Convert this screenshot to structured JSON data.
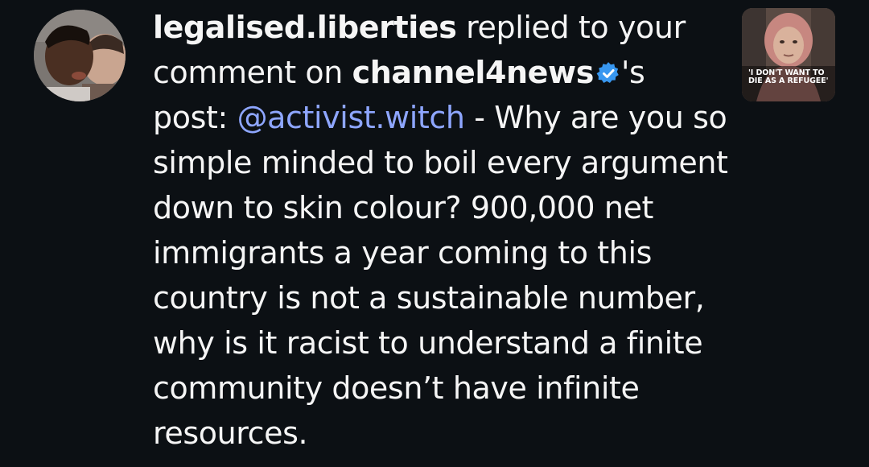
{
  "notification": {
    "username": "legalised.liberties",
    "action_text": " replied to your comment on ",
    "target_account": "channel4news",
    "target_suffix": "'s post: ",
    "mention_glyph": "@",
    "mention": "activist.witch",
    "reply_text": " - Why are you so simple minded to boil every argument down to skin colour? 900,000 net immigrants a year coming to this country is not a sustainable number, why is it racist to understand a finite community doesn’t have infinite resources.",
    "avatar_icon": "user-avatar",
    "verified_icon": "verified-badge-icon",
    "verified_color": "#3897f0",
    "mention_color": "#8ea6ff",
    "background_color": "#0c1014"
  },
  "post_thumbnail": {
    "caption": "'I DON'T WANT TO DIE AS A REFUGEE'"
  }
}
